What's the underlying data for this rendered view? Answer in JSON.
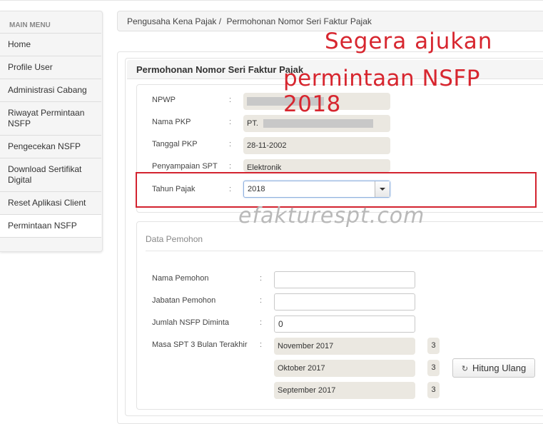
{
  "sidebar": {
    "heading": "MAIN MENU",
    "items": [
      {
        "label": "Home"
      },
      {
        "label": "Profile User"
      },
      {
        "label": "Administrasi Cabang"
      },
      {
        "label": "Riwayat Permintaan NSFP"
      },
      {
        "label": "Pengecekan NSFP"
      },
      {
        "label": "Download Sertifikat Digital"
      },
      {
        "label": "Reset Aplikasi Client"
      },
      {
        "label": "Permintaan NSFP",
        "active": true
      }
    ]
  },
  "breadcrumb": {
    "items": [
      "Pengusaha Kena Pajak /",
      "Permohonan Nomor Seri Faktur Pajak"
    ]
  },
  "panel": {
    "title": "Permohonan Nomor Seri Faktur Pajak"
  },
  "taxpayer": {
    "npwp_label": "NPWP",
    "npwp_value": "",
    "nama_pkp_label": "Nama PKP",
    "nama_pkp_value": "PT.",
    "tanggal_pkp_label": "Tanggal PKP",
    "tanggal_pkp_value": "28-11-2002",
    "penyampaian_label": "Penyampaian SPT",
    "penyampaian_value": "Elektronik",
    "tahun_label": "Tahun Pajak",
    "tahun_value": "2018",
    "colon": ":"
  },
  "pemohon": {
    "section_title": "Data Pemohon",
    "nama_label": "Nama Pemohon",
    "nama_value": "",
    "jabatan_label": "Jabatan Pemohon",
    "jabatan_value": "",
    "jumlah_label": "Jumlah NSFP Diminta",
    "jumlah_value": "0",
    "masa_label": "Masa SPT 3 Bulan Terakhir",
    "masa": [
      {
        "period": "November 2017",
        "count": "3"
      },
      {
        "period": "Oktober 2017",
        "count": "3"
      },
      {
        "period": "September 2017",
        "count": "3"
      }
    ],
    "recalc_button": "Hitung Ulang",
    "recalc_icon": "refresh-icon"
  },
  "annotations": {
    "line1": "Segera ajukan",
    "line2": "permintaan NSFP 2018",
    "watermark": "efakturespt.com",
    "highlight_color": "#d3232f"
  }
}
